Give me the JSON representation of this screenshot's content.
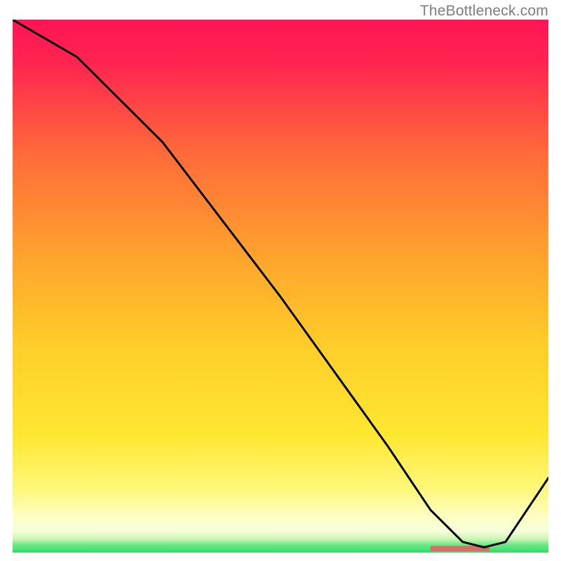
{
  "watermark": "TheBottleneck.com",
  "colors": {
    "curve_stroke": "#000000",
    "green": "#30df64",
    "red_top": "#ff1554",
    "orange_mid": "#ff9a2a",
    "yellow": "#ffe731",
    "pale_yellow": "#ffffa8",
    "marker": "#e26868"
  },
  "chart_data": {
    "type": "line",
    "title": "",
    "xlabel": "",
    "ylabel": "",
    "xlim": [
      0,
      100
    ],
    "ylim": [
      0,
      100
    ],
    "axes_visible": false,
    "grid": false,
    "gradient_background": true,
    "series": [
      {
        "name": "curve",
        "x": [
          0,
          12,
          20,
          28,
          50,
          70,
          78,
          84,
          88,
          92,
          100
        ],
        "y": [
          100,
          93,
          85,
          77,
          48,
          20,
          8,
          2,
          1,
          2,
          14
        ]
      }
    ],
    "marker_band": {
      "x_start": 78,
      "x_end": 89,
      "height_pct": 1.0
    }
  }
}
